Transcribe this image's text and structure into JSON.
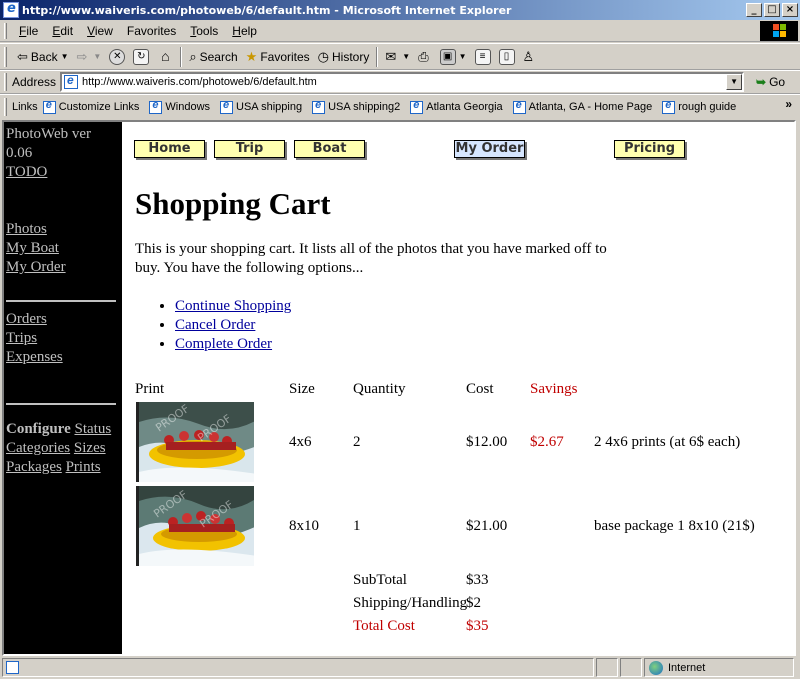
{
  "window": {
    "title": "http://www.waiveris.com/photoweb/6/default.htm - Microsoft Internet Explorer",
    "min_label": "_",
    "max_label": "□",
    "close_label": "×"
  },
  "menu": [
    {
      "u": "F",
      "rest": "ile"
    },
    {
      "u": "E",
      "rest": "dit"
    },
    {
      "u": "V",
      "rest": "iew"
    },
    {
      "u": "F",
      "rest": "avorites",
      "pre": ""
    },
    {
      "u": "T",
      "rest": "ools"
    },
    {
      "u": "H",
      "rest": "elp"
    }
  ],
  "toolbar": {
    "back": "Back",
    "search": "Search",
    "favorites": "Favorites",
    "history": "History"
  },
  "address": {
    "label": "Address",
    "url": "http://www.waiveris.com/photoweb/6/default.htm",
    "go": "Go"
  },
  "links": {
    "label": "Links",
    "items": [
      "Customize Links",
      "Windows",
      "USA shipping",
      "USA shipping2",
      "Atlanta Georgia",
      "Atlanta, GA - Home Page",
      "rough guide"
    ]
  },
  "sidebar": {
    "app_name_1": "PhotoWeb ver",
    "app_name_2": "0.06",
    "todo": "TODO",
    "photos": "Photos",
    "my_boat": "My Boat",
    "my_order": "My Order",
    "orders": "Orders",
    "trips": "Trips",
    "expenses": "Expenses",
    "configure": "Configure",
    "status": "Status",
    "categories": "Categories",
    "sizes": "Sizes",
    "packages": "Packages",
    "prints": "Prints"
  },
  "nav": {
    "home": "Home",
    "trip": "Trip",
    "boat": "Boat",
    "my_order": "My Order",
    "pricing": "Pricing"
  },
  "page": {
    "title": "Shopping Cart",
    "intro": "This is your shopping cart. It lists all of the photos that you have marked off to buy. You have the following options...",
    "options": [
      "Continue Shopping",
      "Cancel Order",
      "Complete Order"
    ]
  },
  "cart": {
    "headers": {
      "print": "Print",
      "size": "Size",
      "quantity": "Quantity",
      "cost": "Cost",
      "savings": "Savings"
    },
    "rows": [
      {
        "size": "4x6",
        "quantity": "2",
        "cost": "$12.00",
        "savings": "$2.67",
        "note": "2 4x6 prints (at 6$ each)"
      },
      {
        "size": "8x10",
        "quantity": "1",
        "cost": "$21.00",
        "savings": "",
        "note": "base package 1 8x10 (21$)"
      }
    ],
    "subtotal_label": "SubTotal",
    "subtotal": "$33",
    "shipping_label": "Shipping/Handling",
    "shipping": "$2",
    "total_label": "Total Cost",
    "total": "$35",
    "watermark": "PROOF"
  },
  "status": {
    "zone": "Internet"
  }
}
